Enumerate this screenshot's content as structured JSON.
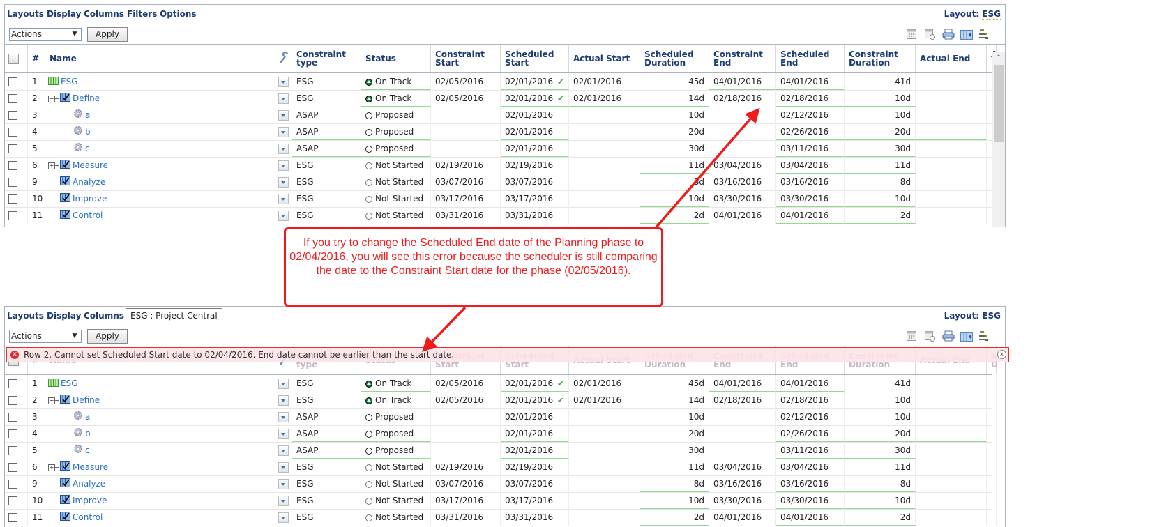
{
  "menus_top": [
    "Layouts",
    "Display",
    "Columns",
    "Filters",
    "Options"
  ],
  "menus_bottom": [
    "Layouts",
    "Display",
    "Columns"
  ],
  "project_tag": "ESG : Project Central",
  "layout": {
    "label": "Layout:",
    "name": "ESG"
  },
  "actions": {
    "select_value": "Actions",
    "apply_label": "Apply"
  },
  "toolbar_icons": [
    "calendar-icon",
    "calendar-clock-icon",
    "print-icon",
    "column-layout-icon",
    "gantt-icon"
  ],
  "columns": {
    "num": "#",
    "name": "Name",
    "constraint_type": "Constraint type",
    "status": "Status",
    "constraint_start": "Constraint Start",
    "scheduled_start": "Scheduled Start",
    "actual_start": "Actual Start",
    "scheduled_duration": "Scheduled Duration",
    "constraint_end": "Constraint End",
    "scheduled_end": "Scheduled End",
    "constraint_duration": "Constraint Duration",
    "actual_end": "Actual End",
    "actual_duration": "Ac D"
  },
  "rows": [
    {
      "num": "1",
      "name": "ESG",
      "icon": "project-icon",
      "level": 0,
      "expander": "",
      "ctype": "ESG",
      "status": "On Track",
      "status_icon": "on-track",
      "cstart": "02/05/2016",
      "sstart": "02/01/2016",
      "sstart_check": true,
      "astart": "02/01/2016",
      "sdur": "45d",
      "cend": "04/01/2016",
      "send": "04/01/2016",
      "cdur": "41d",
      "aend": ""
    },
    {
      "num": "2",
      "name": "Define",
      "icon": "phase-icon",
      "level": 1,
      "expander": "−",
      "ctype": "ESG",
      "status": "On Track",
      "status_icon": "on-track",
      "cstart": "02/05/2016",
      "sstart": "02/01/2016",
      "sstart_check": true,
      "astart": "02/01/2016",
      "sdur": "14d",
      "cend": "02/18/2016",
      "send": "02/18/2016",
      "cdur": "10d",
      "aend": ""
    },
    {
      "num": "3",
      "name": "a",
      "icon": "task-gear-icon",
      "level": 2,
      "expander": "",
      "ctype": "ASAP",
      "status": "Proposed",
      "status_icon": "proposed",
      "cstart": "",
      "sstart": "02/01/2016",
      "sstart_check": false,
      "astart": "",
      "sdur": "10d",
      "cend": "",
      "send": "02/12/2016",
      "cdur": "10d",
      "aend": ""
    },
    {
      "num": "4",
      "name": "b",
      "icon": "task-gear-icon",
      "level": 2,
      "expander": "",
      "ctype": "ASAP",
      "status": "Proposed",
      "status_icon": "proposed",
      "cstart": "",
      "sstart": "02/01/2016",
      "sstart_check": false,
      "astart": "",
      "sdur": "20d",
      "cend": "",
      "send": "02/26/2016",
      "cdur": "20d",
      "aend": ""
    },
    {
      "num": "5",
      "name": "c",
      "icon": "task-gear-icon",
      "level": 2,
      "expander": "",
      "ctype": "ASAP",
      "status": "Proposed",
      "status_icon": "proposed",
      "cstart": "",
      "sstart": "02/01/2016",
      "sstart_check": false,
      "astart": "",
      "sdur": "30d",
      "cend": "",
      "send": "03/11/2016",
      "cdur": "30d",
      "aend": ""
    },
    {
      "num": "6",
      "name": "Measure",
      "icon": "phase-icon",
      "level": 1,
      "expander": "+",
      "ctype": "ESG",
      "status": "Not Started",
      "status_icon": "not-started",
      "cstart": "02/19/2016",
      "sstart": "02/19/2016",
      "sstart_check": false,
      "astart": "",
      "sdur": "11d",
      "cend": "03/04/2016",
      "send": "03/04/2016",
      "cdur": "11d",
      "aend": ""
    },
    {
      "num": "9",
      "name": "Analyze",
      "icon": "phase-icon",
      "level": 1,
      "expander": "",
      "ctype": "ESG",
      "status": "Not Started",
      "status_icon": "not-started",
      "cstart": "03/07/2016",
      "sstart": "03/07/2016",
      "sstart_check": false,
      "astart": "",
      "sdur": "8d",
      "cend": "03/16/2016",
      "send": "03/16/2016",
      "cdur": "8d",
      "aend": ""
    },
    {
      "num": "10",
      "name": "Improve",
      "icon": "phase-icon",
      "level": 1,
      "expander": "",
      "ctype": "ESG",
      "status": "Not Started",
      "status_icon": "not-started",
      "cstart": "03/17/2016",
      "sstart": "03/17/2016",
      "sstart_check": false,
      "astart": "",
      "sdur": "10d",
      "cend": "03/30/2016",
      "send": "03/30/2016",
      "cdur": "10d",
      "aend": ""
    },
    {
      "num": "11",
      "name": "Control",
      "icon": "phase-icon",
      "level": 1,
      "expander": "",
      "ctype": "ESG",
      "status": "Not Started",
      "status_icon": "not-started",
      "cstart": "03/31/2016",
      "sstart": "03/31/2016",
      "sstart_check": false,
      "astart": "",
      "sdur": "2d",
      "cend": "04/01/2016",
      "send": "04/01/2016",
      "cdur": "2d",
      "aend": ""
    }
  ],
  "error_message": "Row 2. Cannot set Scheduled Start date to 02/04/2016. End date cannot be earlier than the start date.",
  "callout_text": "If you try to change the Scheduled End date of the Planning phase to 02/04/2016, you will see this error because the scheduler is still comparing the date to the Constraint Start date for the phase (02/05/2016).",
  "colors": {
    "annotation_red": "#ee1c1c",
    "menu_blue": "#1c3c73",
    "link_blue": "#2a6fc0",
    "editable_underline": "#8fdc8f",
    "error_bg": "#fde2e6"
  }
}
